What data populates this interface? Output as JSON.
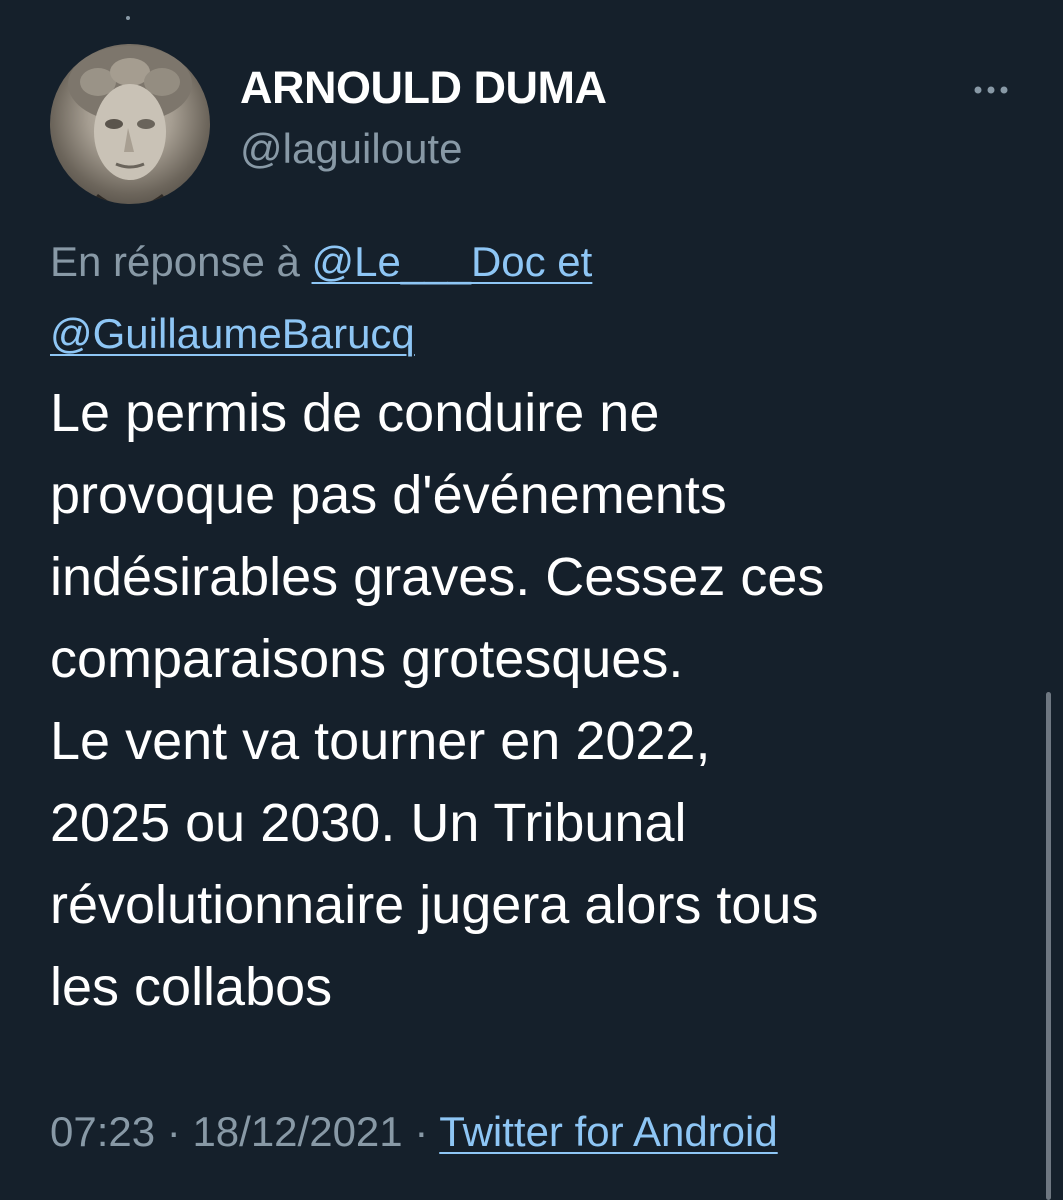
{
  "tweet": {
    "display_name": "ARNOULD DUMA",
    "handle": "@laguiloute",
    "reply_prefix": "En réponse à ",
    "reply_mention_1": "@Le___Doc et",
    "reply_mention_2": "@GuillaumeBarucq",
    "text_lines": [
      "Le permis de conduire ne",
      "provoque pas d'événements",
      "indésirables graves. Cessez ces",
      "comparaisons grotesques.",
      "Le vent va tourner en 2022,",
      "2025 ou 2030. Un Tribunal",
      "révolutionnaire jugera alors tous",
      "les collabos"
    ],
    "time": "07:23",
    "separator": " · ",
    "date": "18/12/2021",
    "source": "Twitter for Android"
  },
  "icons": {
    "more": "more-horizontal-icon",
    "avatar": "sculpted-head-avatar"
  },
  "colors": {
    "background": "#15202b",
    "primary_text": "#ffffff",
    "secondary_text": "#8899a6",
    "link": "#8ec6f5"
  }
}
